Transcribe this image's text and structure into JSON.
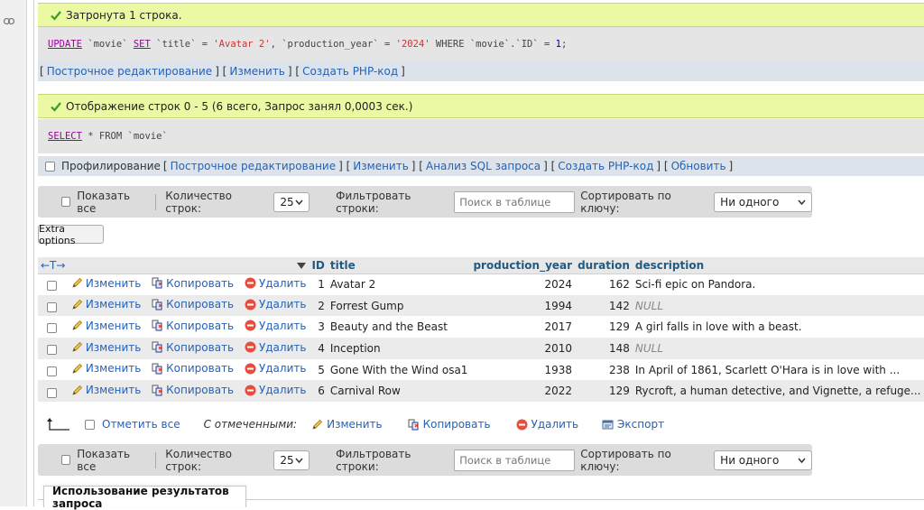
{
  "update_message": "Затронута 1 строка.",
  "update_sql": {
    "parts": [
      "UPDATE",
      " `movie` ",
      "SET",
      " `title` = ",
      "'Avatar 2'",
      ", `production_year` = ",
      "'2024'",
      " WHERE `movie`.`ID` = ",
      "1",
      ";"
    ]
  },
  "update_links": {
    "open": "[",
    "inline_edit": "Построчное редактирование",
    "sep1": "] [",
    "edit": "Изменить",
    "sep2": "] [",
    "php": "Создать PHP-код",
    "close": "]"
  },
  "select_message": "Отображение строк 0 - 5 (6 всего, Запрос занял 0,0003 сек.)",
  "select_sql": {
    "parts": [
      "SELECT",
      " * FROM `movie`"
    ]
  },
  "select_links": {
    "profiling": "Профилирование",
    "open": "[",
    "inline_edit": "Построчное редактирование",
    "sep1": "] [",
    "edit": "Изменить",
    "sep2": "] [",
    "analyze": "Анализ SQL запроса",
    "sep3": "] [",
    "php": "Создать PHP-код",
    "sep4": "] [",
    "refresh": "Обновить",
    "close": "]"
  },
  "nav": {
    "show_all": "Показать все",
    "row_count_label": "Количество строк:",
    "row_count_value": "25",
    "filter_label": "Фильтровать строки:",
    "filter_placeholder": "Поиск в таблице",
    "sort_label": "Сортировать по ключу:",
    "sort_value": "Ни одного"
  },
  "extra_options": "Extra options",
  "table": {
    "nav_arrows": "←T→",
    "columns": [
      "ID",
      "title",
      "production_year",
      "duration",
      "description"
    ],
    "actions": {
      "edit": "Изменить",
      "copy": "Копировать",
      "delete": "Удалить"
    },
    "rows": [
      {
        "id": "1",
        "title": "Avatar 2",
        "year": "2024",
        "duration": "162",
        "description": "Sci-fi epic on Pandora.",
        "null": false
      },
      {
        "id": "2",
        "title": "Forrest Gump",
        "year": "1994",
        "duration": "142",
        "description": "NULL",
        "null": true
      },
      {
        "id": "3",
        "title": "Beauty and the Beast",
        "year": "2017",
        "duration": "129",
        "description": "A girl falls in love with a beast.",
        "null": false
      },
      {
        "id": "4",
        "title": "Inception",
        "year": "2010",
        "duration": "148",
        "description": "NULL",
        "null": true
      },
      {
        "id": "5",
        "title": "Gone With the Wind osa1",
        "year": "1938",
        "duration": "238",
        "description": "In April of 1861, Scarlett O'Hara is in love with ...",
        "null": false
      },
      {
        "id": "6",
        "title": "Carnival Row",
        "year": "2022",
        "duration": "129",
        "description": "Rycroft, a human detective, and Vignette, a refuge...",
        "null": false
      }
    ]
  },
  "bulk": {
    "check_all": "Отметить все",
    "with_selected": "С отмеченными:",
    "edit": "Изменить",
    "copy": "Копировать",
    "delete": "Удалить",
    "export": "Экспорт"
  },
  "usage_title": "Использование результатов запроса",
  "colors": {
    "success_bg": "#ebf8a4",
    "link": "#2562b8",
    "header_text": "#235a81",
    "keyword": "#990099",
    "string": "#cc3333"
  }
}
